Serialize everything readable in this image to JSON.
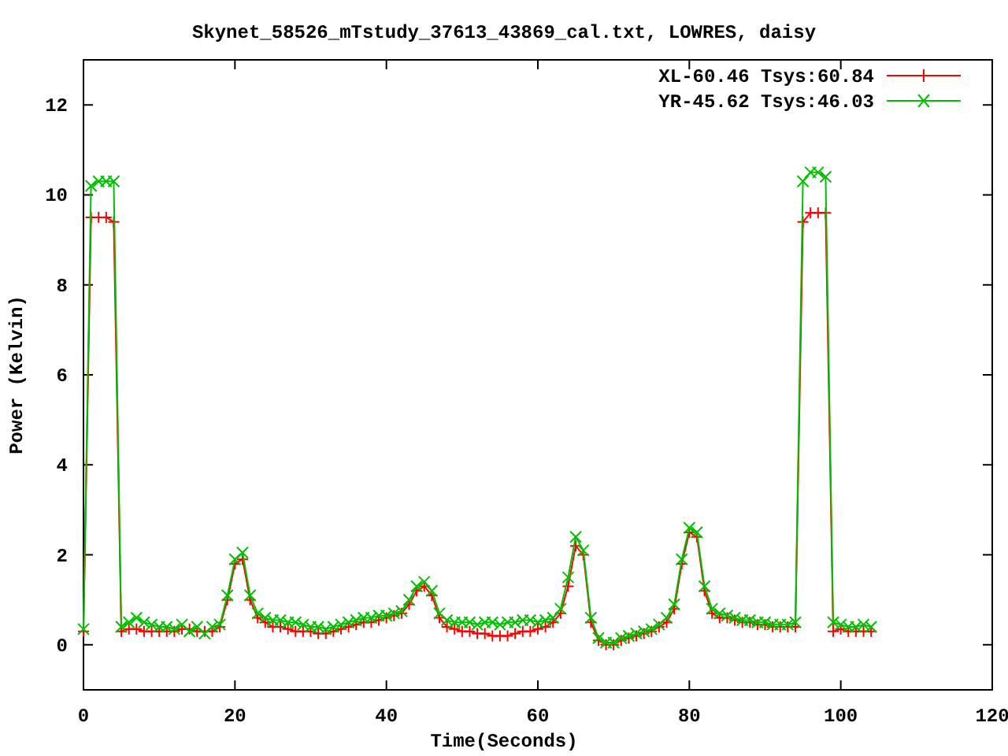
{
  "chart": {
    "chart_data": {
      "type": "line",
      "title": "Skynet_58526_mTstudy_37613_43869_cal.txt, LOWRES, daisy",
      "xlabel": "Time(Seconds)",
      "ylabel": "Power (Kelvin)",
      "x": [
        0,
        1,
        2,
        3,
        4,
        5,
        6,
        7,
        8,
        9,
        10,
        11,
        12,
        13,
        14,
        15,
        16,
        17,
        18,
        19,
        20,
        21,
        22,
        23,
        24,
        25,
        26,
        27,
        28,
        29,
        30,
        31,
        32,
        33,
        34,
        35,
        36,
        37,
        38,
        39,
        40,
        41,
        42,
        43,
        44,
        45,
        46,
        47,
        48,
        49,
        50,
        51,
        52,
        53,
        54,
        55,
        56,
        57,
        58,
        59,
        60,
        61,
        62,
        63,
        64,
        65,
        66,
        67,
        68,
        69,
        70,
        71,
        72,
        73,
        74,
        75,
        76,
        77,
        78,
        79,
        80,
        81,
        82,
        83,
        84,
        85,
        86,
        87,
        88,
        89,
        90,
        91,
        92,
        93,
        94,
        95,
        96,
        97,
        98,
        99,
        100,
        101,
        102,
        103,
        104
      ],
      "series": [
        {
          "name": "XL-60.46 Tsys:60.84",
          "color": "#ff0000",
          "marker": "plus",
          "values": [
            0.3,
            9.5,
            9.5,
            9.5,
            9.4,
            0.3,
            0.35,
            0.35,
            0.3,
            0.3,
            0.3,
            0.3,
            0.3,
            0.35,
            0.35,
            0.3,
            0.3,
            0.3,
            0.4,
            1.0,
            1.8,
            1.9,
            1.0,
            0.6,
            0.5,
            0.4,
            0.4,
            0.35,
            0.3,
            0.3,
            0.3,
            0.25,
            0.25,
            0.3,
            0.35,
            0.4,
            0.45,
            0.5,
            0.5,
            0.55,
            0.6,
            0.65,
            0.7,
            0.9,
            1.2,
            1.3,
            1.1,
            0.6,
            0.4,
            0.35,
            0.3,
            0.3,
            0.25,
            0.25,
            0.2,
            0.2,
            0.2,
            0.25,
            0.3,
            0.3,
            0.35,
            0.4,
            0.5,
            0.7,
            1.3,
            2.2,
            2.0,
            0.5,
            0.1,
            0,
            0,
            0.1,
            0.15,
            0.2,
            0.25,
            0.3,
            0.4,
            0.5,
            0.8,
            1.8,
            2.5,
            2.4,
            1.2,
            0.7,
            0.6,
            0.6,
            0.55,
            0.5,
            0.5,
            0.45,
            0.45,
            0.4,
            0.4,
            0.4,
            0.4,
            9.4,
            9.6,
            9.6,
            9.6,
            0.3,
            0.35,
            0.3,
            0.3,
            0.3,
            0.3
          ]
        },
        {
          "name": "YR-45.62 Tsys:46.03",
          "color": "#00c000",
          "marker": "cross",
          "values": [
            0.35,
            10.2,
            10.3,
            10.3,
            10.3,
            0.4,
            0.5,
            0.6,
            0.5,
            0.45,
            0.4,
            0.4,
            0.35,
            0.45,
            0.3,
            0.4,
            0.25,
            0.4,
            0.45,
            1.1,
            1.9,
            2.05,
            1.1,
            0.7,
            0.6,
            0.55,
            0.55,
            0.5,
            0.5,
            0.45,
            0.4,
            0.4,
            0.35,
            0.4,
            0.45,
            0.5,
            0.55,
            0.6,
            0.6,
            0.65,
            0.65,
            0.7,
            0.75,
            1.0,
            1.3,
            1.4,
            1.2,
            0.7,
            0.55,
            0.5,
            0.5,
            0.5,
            0.45,
            0.5,
            0.5,
            0.45,
            0.5,
            0.5,
            0.55,
            0.55,
            0.5,
            0.55,
            0.6,
            0.8,
            1.5,
            2.4,
            2.1,
            0.6,
            0.15,
            0.05,
            0.05,
            0.15,
            0.2,
            0.25,
            0.3,
            0.35,
            0.45,
            0.6,
            0.9,
            1.9,
            2.6,
            2.5,
            1.3,
            0.8,
            0.7,
            0.65,
            0.6,
            0.55,
            0.55,
            0.5,
            0.5,
            0.45,
            0.45,
            0.45,
            0.5,
            10.3,
            10.5,
            10.5,
            10.4,
            0.5,
            0.45,
            0.4,
            0.4,
            0.45,
            0.4
          ]
        }
      ],
      "legend": true,
      "xlim": [
        0,
        120
      ],
      "ylim": [
        -1,
        13
      ],
      "xticks": [
        0,
        20,
        40,
        60,
        80,
        100,
        120
      ],
      "yticks": [
        0,
        2,
        4,
        6,
        8,
        10,
        12
      ]
    }
  }
}
